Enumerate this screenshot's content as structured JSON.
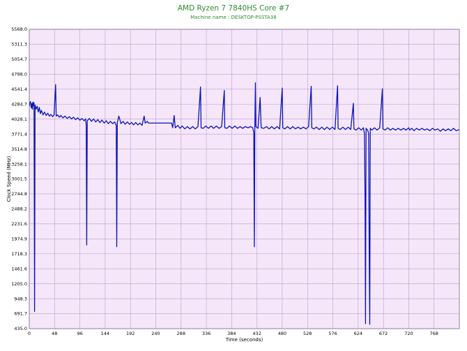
{
  "chart_data": {
    "type": "line",
    "title": "AMD Ryzen 7 7840HS Core #7",
    "subtitle": "Machine name : DESKTOP-PSSTA38",
    "xlabel": "Time (seconds)",
    "ylabel": "Clock Speed (MHz)",
    "xlim": [
      0,
      816
    ],
    "ylim": [
      435.0,
      5568.0
    ],
    "x_ticks": [
      0,
      48,
      96,
      144,
      192,
      240,
      288,
      336,
      384,
      432,
      480,
      528,
      576,
      624,
      672,
      720,
      768
    ],
    "y_ticks": [
      435.0,
      691.7,
      948.3,
      1205.0,
      1461.6,
      1718.3,
      1974.9,
      2231.6,
      2488.2,
      2744.8,
      3001.5,
      3258.1,
      3514.8,
      3771.4,
      4028.1,
      4284.7,
      4541.4,
      4798.0,
      5054.7,
      5311.3,
      5568.0
    ],
    "grid": true,
    "colors": {
      "line": "#0a14b4",
      "plot_bg": "#f5e6fa",
      "grid": "#b9a2c8",
      "title": "#2e8b2e"
    },
    "series": [
      {
        "points": [
          [
            0,
            4250
          ],
          [
            2,
            4330
          ],
          [
            4,
            4220
          ],
          [
            5,
            4300
          ],
          [
            6,
            4200
          ],
          [
            7,
            4320
          ],
          [
            8,
            4260
          ],
          [
            9,
            4310
          ],
          [
            10,
            730
          ],
          [
            11,
            4270
          ],
          [
            13,
            4200
          ],
          [
            15,
            4250
          ],
          [
            17,
            4150
          ],
          [
            19,
            4230
          ],
          [
            21,
            4120
          ],
          [
            23,
            4180
          ],
          [
            26,
            4100
          ],
          [
            29,
            4150
          ],
          [
            32,
            4090
          ],
          [
            35,
            4130
          ],
          [
            38,
            4080
          ],
          [
            41,
            4110
          ],
          [
            44,
            4070
          ],
          [
            47,
            4100
          ],
          [
            50,
            4620
          ],
          [
            51,
            4080
          ],
          [
            54,
            4100
          ],
          [
            57,
            4060
          ],
          [
            60,
            4090
          ],
          [
            64,
            4050
          ],
          [
            68,
            4080
          ],
          [
            72,
            4040
          ],
          [
            76,
            4070
          ],
          [
            80,
            4030
          ],
          [
            84,
            4060
          ],
          [
            88,
            4020
          ],
          [
            92,
            4050
          ],
          [
            96,
            4010
          ],
          [
            100,
            4040
          ],
          [
            104,
            4000
          ],
          [
            107,
            4030
          ],
          [
            108,
            3920
          ],
          [
            109,
            1870
          ],
          [
            110,
            4000
          ],
          [
            114,
            4040
          ],
          [
            118,
            3990
          ],
          [
            122,
            4030
          ],
          [
            126,
            3980
          ],
          [
            130,
            4020
          ],
          [
            134,
            3970
          ],
          [
            138,
            4010
          ],
          [
            142,
            3960
          ],
          [
            146,
            4000
          ],
          [
            150,
            3950
          ],
          [
            154,
            3990
          ],
          [
            158,
            3950
          ],
          [
            162,
            3980
          ],
          [
            165,
            3920
          ],
          [
            166,
            1840
          ],
          [
            167,
            3970
          ],
          [
            170,
            4080
          ],
          [
            174,
            3950
          ],
          [
            178,
            3990
          ],
          [
            182,
            3940
          ],
          [
            186,
            3980
          ],
          [
            190,
            3940
          ],
          [
            194,
            3970
          ],
          [
            198,
            3930
          ],
          [
            202,
            3970
          ],
          [
            206,
            3930
          ],
          [
            210,
            3960
          ],
          [
            214,
            3920
          ],
          [
            218,
            4080
          ],
          [
            220,
            3960
          ],
          [
            224,
            3990
          ],
          [
            226,
            3960
          ],
          [
            270,
            3960
          ],
          [
            272,
            3880
          ],
          [
            275,
            4090
          ],
          [
            277,
            3880
          ],
          [
            282,
            3920
          ],
          [
            286,
            3870
          ],
          [
            290,
            3910
          ],
          [
            295,
            3860
          ],
          [
            300,
            3900
          ],
          [
            305,
            3860
          ],
          [
            310,
            3900
          ],
          [
            315,
            3860
          ],
          [
            320,
            3900
          ],
          [
            325,
            4580
          ],
          [
            326,
            3880
          ],
          [
            330,
            3870
          ],
          [
            335,
            3910
          ],
          [
            340,
            3870
          ],
          [
            345,
            3910
          ],
          [
            350,
            3870
          ],
          [
            355,
            3910
          ],
          [
            360,
            3870
          ],
          [
            365,
            3900
          ],
          [
            370,
            4520
          ],
          [
            371,
            3880
          ],
          [
            375,
            3870
          ],
          [
            380,
            3910
          ],
          [
            385,
            3870
          ],
          [
            390,
            3910
          ],
          [
            395,
            3870
          ],
          [
            400,
            3900
          ],
          [
            405,
            3870
          ],
          [
            410,
            3900
          ],
          [
            415,
            3880
          ],
          [
            420,
            3900
          ],
          [
            424,
            3880
          ],
          [
            426,
            3800
          ],
          [
            427,
            1840
          ],
          [
            428,
            3880
          ],
          [
            429,
            4650
          ],
          [
            430,
            3900
          ],
          [
            434,
            3870
          ],
          [
            438,
            4400
          ],
          [
            440,
            3880
          ],
          [
            445,
            3870
          ],
          [
            450,
            3900
          ],
          [
            455,
            3860
          ],
          [
            460,
            3900
          ],
          [
            465,
            3860
          ],
          [
            470,
            3900
          ],
          [
            475,
            3860
          ],
          [
            480,
            4560
          ],
          [
            481,
            3880
          ],
          [
            485,
            3860
          ],
          [
            490,
            3900
          ],
          [
            495,
            3860
          ],
          [
            500,
            3900
          ],
          [
            505,
            3860
          ],
          [
            510,
            3890
          ],
          [
            515,
            3860
          ],
          [
            520,
            3890
          ],
          [
            525,
            3860
          ],
          [
            530,
            3900
          ],
          [
            535,
            4590
          ],
          [
            536,
            3880
          ],
          [
            540,
            3860
          ],
          [
            545,
            3890
          ],
          [
            550,
            3850
          ],
          [
            555,
            3890
          ],
          [
            560,
            3850
          ],
          [
            565,
            3890
          ],
          [
            570,
            3850
          ],
          [
            575,
            3890
          ],
          [
            580,
            3850
          ],
          [
            585,
            4600
          ],
          [
            586,
            3870
          ],
          [
            590,
            3850
          ],
          [
            595,
            3890
          ],
          [
            600,
            3850
          ],
          [
            605,
            3890
          ],
          [
            610,
            3850
          ],
          [
            615,
            4300
          ],
          [
            616,
            3860
          ],
          [
            620,
            3840
          ],
          [
            625,
            3880
          ],
          [
            630,
            3840
          ],
          [
            634,
            3880
          ],
          [
            636,
            3780
          ],
          [
            637,
            2700
          ],
          [
            638,
            520
          ],
          [
            639,
            3870
          ],
          [
            642,
            3840
          ],
          [
            644,
            3780
          ],
          [
            645,
            1720
          ],
          [
            646,
            510
          ],
          [
            647,
            3870
          ],
          [
            650,
            3840
          ],
          [
            655,
            3880
          ],
          [
            660,
            3840
          ],
          [
            665,
            3880
          ],
          [
            670,
            4550
          ],
          [
            671,
            3860
          ],
          [
            675,
            3840
          ],
          [
            680,
            3880
          ],
          [
            685,
            3840
          ],
          [
            690,
            3870
          ],
          [
            695,
            3840
          ],
          [
            700,
            3870
          ],
          [
            705,
            3840
          ],
          [
            710,
            3870
          ],
          [
            715,
            3840
          ],
          [
            720,
            3880
          ],
          [
            722,
            3840
          ],
          [
            726,
            3870
          ],
          [
            730,
            3830
          ],
          [
            735,
            3870
          ],
          [
            740,
            3840
          ],
          [
            745,
            3870
          ],
          [
            750,
            3840
          ],
          [
            755,
            3860
          ],
          [
            760,
            3830
          ],
          [
            765,
            3870
          ],
          [
            770,
            3840
          ],
          [
            775,
            3860
          ],
          [
            780,
            3820
          ],
          [
            785,
            3860
          ],
          [
            790,
            3830
          ],
          [
            795,
            3860
          ],
          [
            800,
            3830
          ],
          [
            805,
            3870
          ],
          [
            810,
            3830
          ],
          [
            816,
            3850
          ]
        ]
      }
    ]
  }
}
